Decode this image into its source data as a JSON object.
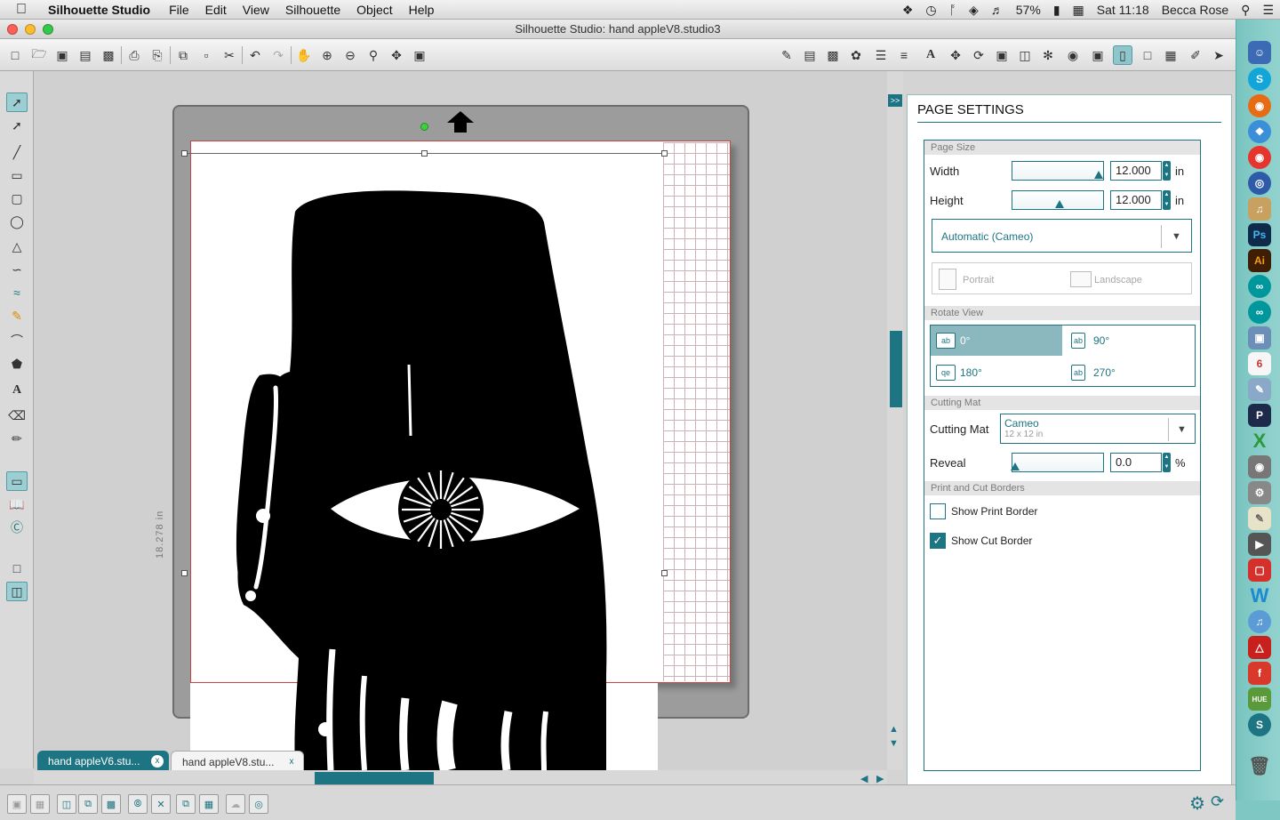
{
  "menubar": {
    "apple": "",
    "app_name": "Silhouette Studio",
    "items": [
      "File",
      "Edit",
      "View",
      "Silhouette",
      "Object",
      "Help"
    ],
    "battery": "57%",
    "clock": "Sat 11:18",
    "user": "Becca Rose"
  },
  "window": {
    "title": "Silhouette Studio: hand appleV8.studio3"
  },
  "canvas": {
    "dimension_label": "18.278 in"
  },
  "doc_tabs": [
    {
      "label": "hand appleV6.stu...",
      "close": "x"
    },
    {
      "label": "hand appleV8.stu...",
      "close": "x"
    }
  ],
  "panel": {
    "title": "PAGE SETTINGS",
    "page_size": {
      "heading": "Page Size",
      "width_label": "Width",
      "width_value": "12.000",
      "height_label": "Height",
      "height_value": "12.000",
      "unit": "in",
      "preset": "Automatic (Cameo)",
      "portrait": "Portrait",
      "landscape": "Landscape"
    },
    "rotate_view": {
      "heading": "Rotate View",
      "options": [
        {
          "label": "0°",
          "icon": "ab",
          "active": true
        },
        {
          "label": "90°",
          "icon": "ab",
          "active": false
        },
        {
          "label": "180°",
          "icon": "qe",
          "active": false
        },
        {
          "label": "270°",
          "icon": "ab",
          "active": false
        }
      ]
    },
    "cutting_mat": {
      "heading": "Cutting Mat",
      "label": "Cutting Mat",
      "mat_name": "Cameo",
      "mat_size": "12 x 12 in",
      "reveal_label": "Reveal",
      "reveal_value": "0.0",
      "reveal_unit": "%"
    },
    "borders": {
      "heading": "Print and Cut Borders",
      "show_print_border": "Show Print Border",
      "show_print_border_checked": false,
      "show_cut_border": "Show Cut Border",
      "show_cut_border_checked": true
    }
  },
  "colors": {
    "accent": "#1d7482",
    "mat": "#9c9c9c",
    "page_border": "#cc4444"
  }
}
